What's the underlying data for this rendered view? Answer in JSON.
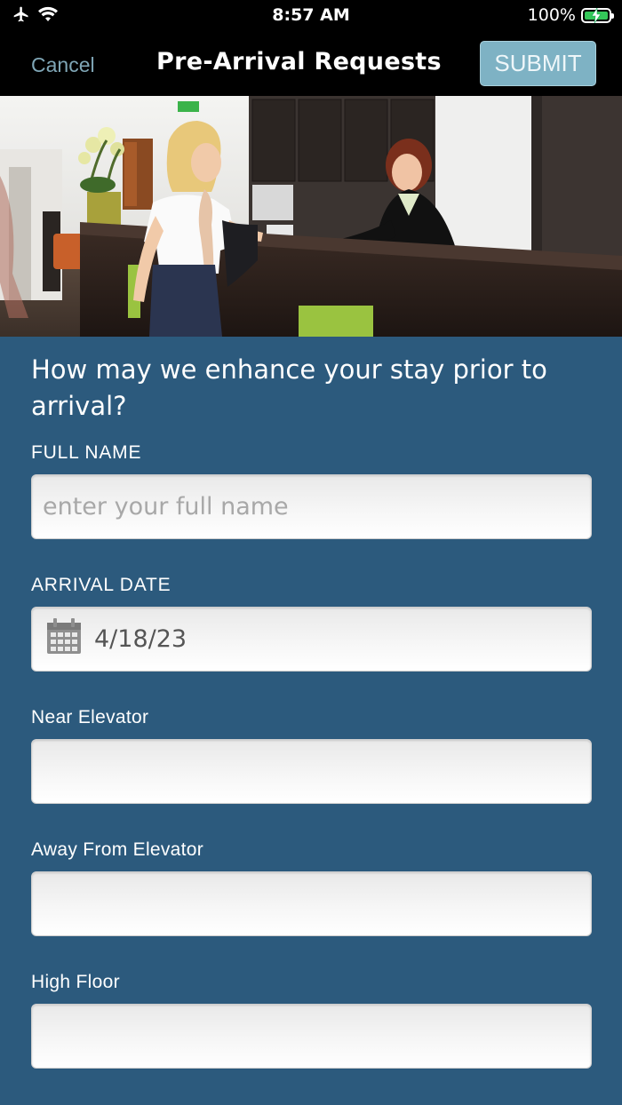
{
  "status_bar": {
    "time": "8:57 AM",
    "battery_percent": "100%",
    "icons": [
      "airplane-icon",
      "wifi-icon",
      "battery-charging-icon"
    ]
  },
  "nav": {
    "cancel_label": "Cancel",
    "title": "Pre-Arrival Requests",
    "submit_label": "SUBMIT"
  },
  "hero": {
    "image": "hotel-reception-photo"
  },
  "form": {
    "question": "How may we enhance your stay prior to arrival?",
    "fields": [
      {
        "label": "FULL NAME",
        "value": "",
        "placeholder": "enter your full name"
      },
      {
        "label": "ARRIVAL DATE",
        "value": "4/18/23",
        "icon": "calendar-icon"
      },
      {
        "label": "Near Elevator",
        "value": ""
      },
      {
        "label": "Away From Elevator",
        "value": ""
      },
      {
        "label": "High Floor",
        "value": ""
      }
    ]
  },
  "colors": {
    "background": "#2c5a7d",
    "submit_button": "#7eb2c4",
    "cancel_text": "#7fa6b6",
    "battery": "#34c759"
  }
}
